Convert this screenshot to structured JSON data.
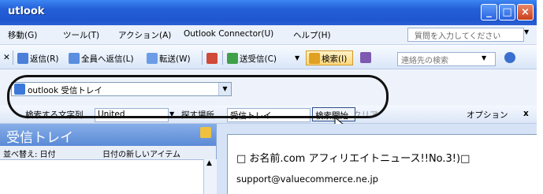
{
  "window": {
    "title": "utlook"
  },
  "menu": {
    "items": [
      "移動(G)",
      "ツール(T)",
      "アクション(A)",
      "Outlook Connector(U)",
      "ヘルプ(H)"
    ],
    "ask_placeholder": "質問を入力してください"
  },
  "toolbar": {
    "reply": "返信(R)",
    "reply_all": "全員へ返信(L)",
    "forward": "転送(W)",
    "send_receive": "送受信(C)",
    "search": "検索(I)",
    "contact_placeholder": "連絡先の検索"
  },
  "folder_combo": {
    "value": "outlook 受信トレイ"
  },
  "search_bar": {
    "find_label": "検索する文字列",
    "find_value": "United",
    "location_label": "探す場所",
    "location_value": "受信トレイ",
    "start_button": "検索開始",
    "clear": "クリア",
    "options": "オプション",
    "close": "x"
  },
  "folder_pane": {
    "title": "受信トレイ",
    "sort_label": "並べ替え: 日付",
    "sort_order": "日付の新しいアイテム"
  },
  "reading": {
    "subject": "□ お名前.com アフィリエイトニュース!!No.3!)□",
    "from": "support@valuecommerce.ne.jp"
  },
  "colors": {
    "accent": "#2460d8",
    "highlight": "#ffd77a"
  }
}
